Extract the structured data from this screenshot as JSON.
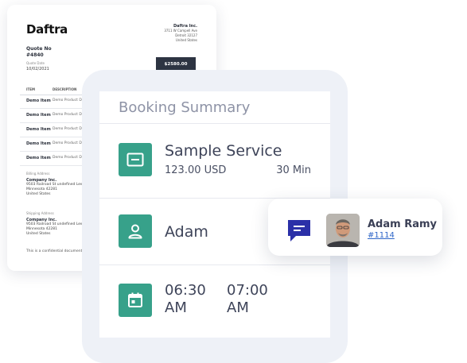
{
  "quote": {
    "logo": "Daftra",
    "company_name": "Daftra Inc.",
    "company_address": [
      "3711 W Campell Ave",
      "Detroit 32127",
      "United States"
    ],
    "quote_no_label": "Quote No",
    "quote_no": "#4840",
    "date_label": "Quote Date",
    "date": "10/02/2021",
    "total": "$2580.00",
    "col_item": "ITEM",
    "col_description": "DESCRIPTION",
    "rows": [
      {
        "item": "Demo Item",
        "desc": "Demo Product Des"
      },
      {
        "item": "Demo Item",
        "desc": "Demo Product Des"
      },
      {
        "item": "Demo Item",
        "desc": "Demo Product Des"
      },
      {
        "item": "Demo Item",
        "desc": "Demo Product Des"
      },
      {
        "item": "Demo Item",
        "desc": "Demo Product Des"
      }
    ],
    "billing": {
      "label": "Billing Address",
      "company": "Company Inc.",
      "lines": [
        "9503 Railroad St undefined Lew",
        "Minnesota 42281",
        "United States"
      ]
    },
    "shipping": {
      "label": "Shipping Address",
      "company": "Company Inc.",
      "lines": [
        "9503 Railroad St undefined Lew",
        "Minnesota 42281",
        "United States"
      ]
    },
    "footer": "This is a confidential document"
  },
  "booking": {
    "title": "Booking Summary",
    "service": {
      "name": "Sample Service",
      "price": "123.00 USD",
      "duration": "30 Min",
      "icon": "ticket-icon"
    },
    "staff": {
      "name": "Adam",
      "icon": "user-icon"
    },
    "time": {
      "start_time": "06:30",
      "start_period": "AM",
      "end_time": "07:00",
      "end_period": "AM",
      "icon": "calendar-icon"
    }
  },
  "client": {
    "name": "Adam Ramy",
    "id": "#1114",
    "icon": "chat-icon"
  },
  "colors": {
    "accent": "#37a18a",
    "chat": "#2b30a8",
    "link": "#2f66c8"
  }
}
